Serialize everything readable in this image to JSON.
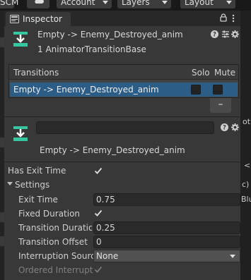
{
  "toolbar": {
    "scm_label": "SCM",
    "account_label": "Account",
    "layers_label": "Layers",
    "layout_label": "Layout"
  },
  "inspector": {
    "tab_label": "Inspector",
    "header_title": "Empty -> Enemy_Destroyed_anim",
    "header_subtitle": "1 AnimatorTransitionBase"
  },
  "transitions_list": {
    "header": {
      "name": "Transitions",
      "solo": "Solo",
      "mute": "Mute"
    },
    "rows": [
      {
        "name": "Empty -> Enemy_Destroyed_anim",
        "solo": false,
        "mute": false,
        "selected": true
      }
    ],
    "remove_label": "–"
  },
  "transition": {
    "name_value": "",
    "title": "Empty -> Enemy_Destroyed_anim"
  },
  "properties": {
    "has_exit_time": {
      "label": "Has Exit Time",
      "checked": true
    },
    "settings": {
      "label": "Settings",
      "expanded": true
    },
    "exit_time": {
      "label": "Exit Time",
      "value": "0.75"
    },
    "fixed_duration": {
      "label": "Fixed Duration",
      "checked": true
    },
    "transition_duration": {
      "label": "Transition Duration",
      "value": "0.25"
    },
    "transition_offset": {
      "label": "Transition Offset",
      "value": "0"
    },
    "interruption_source": {
      "label": "Interruption Source",
      "value": "None"
    },
    "ordered_interruption": {
      "label": "Ordered Interruption",
      "checked": true,
      "disabled": true
    }
  },
  "background": {
    "right_text_1": "ot",
    "right_text_2": "<",
    "right_text_3": "c)",
    "right_text_4": "Blu"
  },
  "colors": {
    "panel_bg": "#383838",
    "selection": "#2c5d87",
    "field_bg": "#2a2a2a",
    "accent_green": "#35c7a0"
  },
  "icons": [
    "cloud-icon",
    "inspector-icon",
    "lock-icon",
    "kebab-menu-icon",
    "transition-icon",
    "help-icon",
    "presets-icon",
    "settings-icon",
    "checkmark-icon",
    "foldout-arrow-icon",
    "dropdown-arrow-icon"
  ]
}
